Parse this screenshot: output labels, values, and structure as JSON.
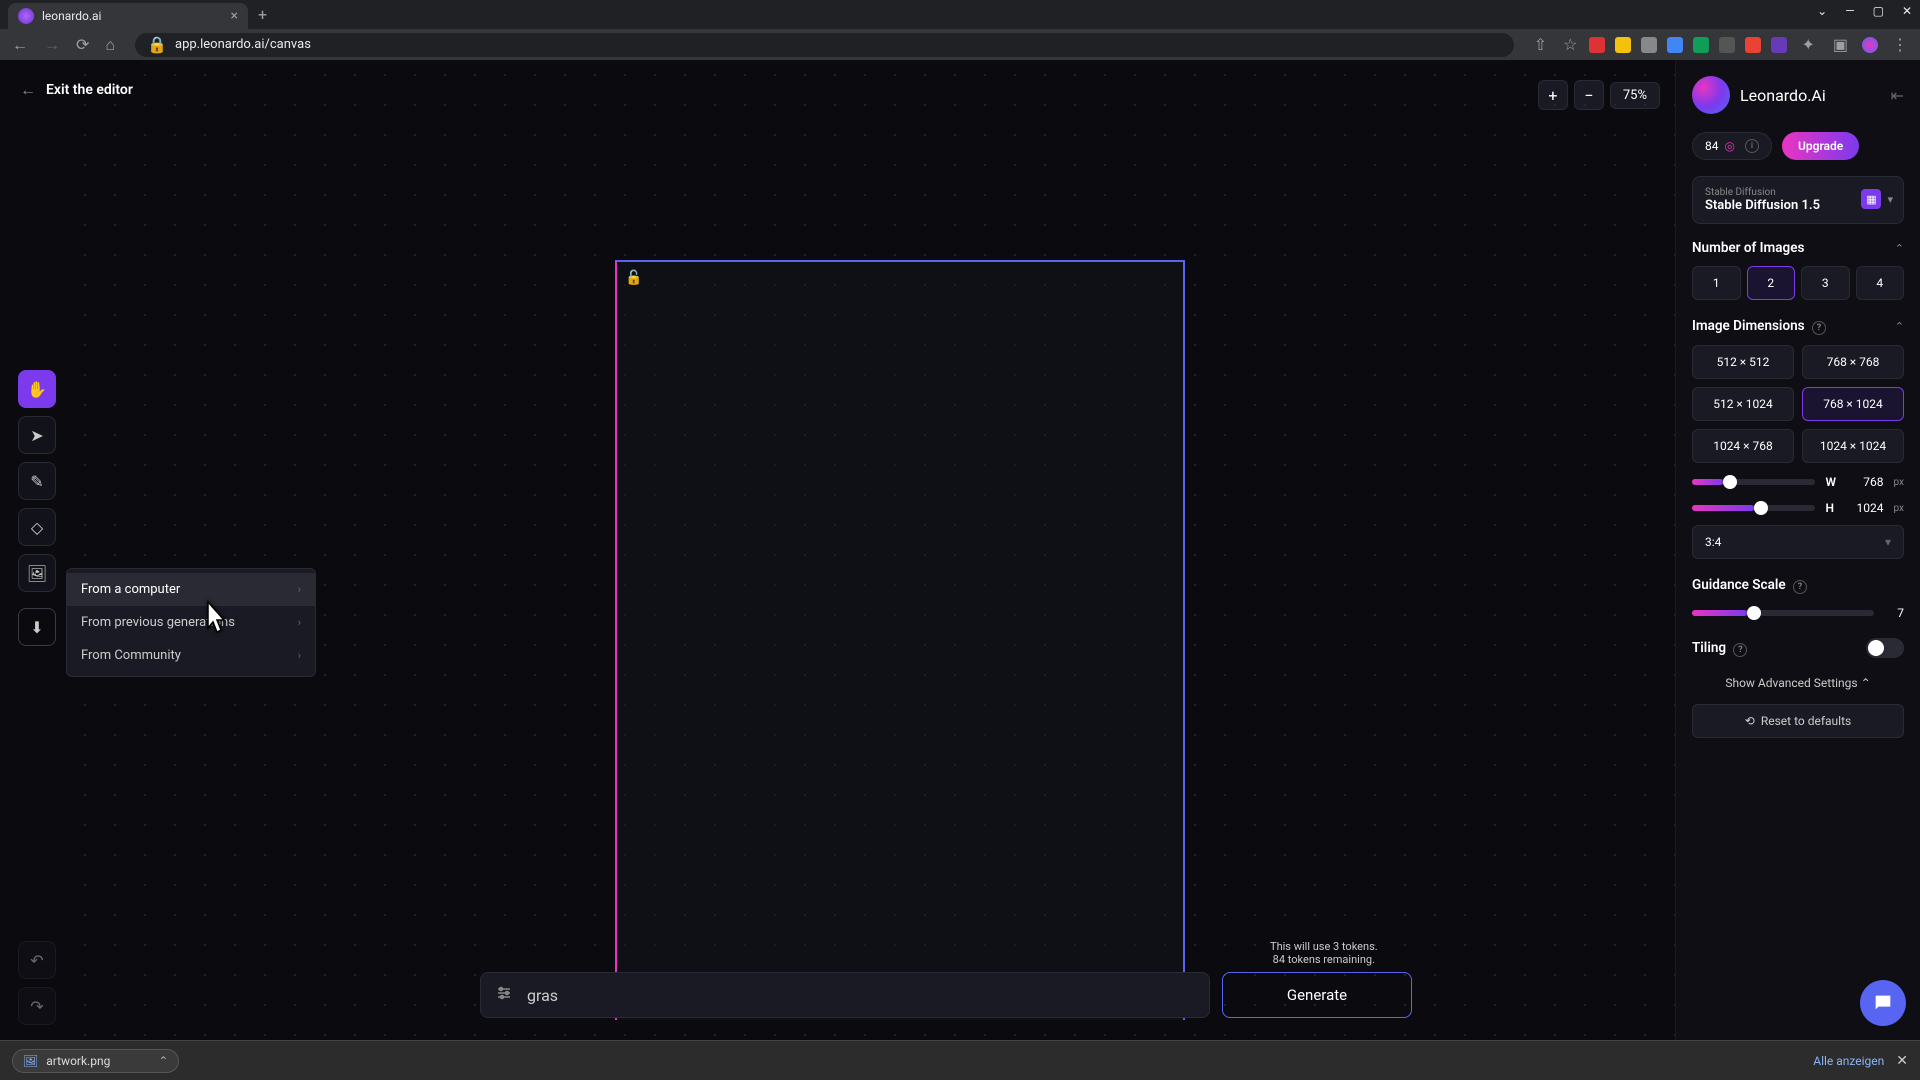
{
  "browser": {
    "tab_title": "leonardo.ai",
    "url": "app.leonardo.ai/canvas"
  },
  "topbar": {
    "exit_label": "Exit the editor",
    "zoom_level": "75%"
  },
  "tools": {
    "context_menu": {
      "items": [
        {
          "label": "From a computer"
        },
        {
          "label": "From previous generations"
        },
        {
          "label": "From Community"
        }
      ]
    }
  },
  "prompt": {
    "value": "gras",
    "generate_label": "Generate",
    "token_line1": "This will use 3 tokens.",
    "token_line2": "84 tokens remaining."
  },
  "sidebar": {
    "brand": "Leonardo.Ai",
    "credits": "84",
    "upgrade_label": "Upgrade",
    "model": {
      "provider": "Stable Diffusion",
      "name": "Stable Diffusion 1.5"
    },
    "num_images": {
      "title": "Number of Images",
      "options": [
        "1",
        "2",
        "3",
        "4"
      ],
      "selected": "2"
    },
    "dimensions": {
      "title": "Image Dimensions",
      "presets": [
        "512 × 512",
        "768 × 768",
        "512 × 1024",
        "768 × 1024",
        "1024 × 768",
        "1024 × 1024"
      ],
      "selected": "768 × 1024",
      "width_label": "W",
      "width_value": "768",
      "height_label": "H",
      "height_value": "1024",
      "unit": "px",
      "ratio": "3:4"
    },
    "guidance": {
      "title": "Guidance Scale",
      "value": "7"
    },
    "tiling": {
      "title": "Tiling"
    },
    "advanced_label": "Show Advanced Settings",
    "reset_label": "Reset to defaults"
  },
  "downloads": {
    "file": "artwork.png",
    "show_all": "Alle anzeigen"
  }
}
